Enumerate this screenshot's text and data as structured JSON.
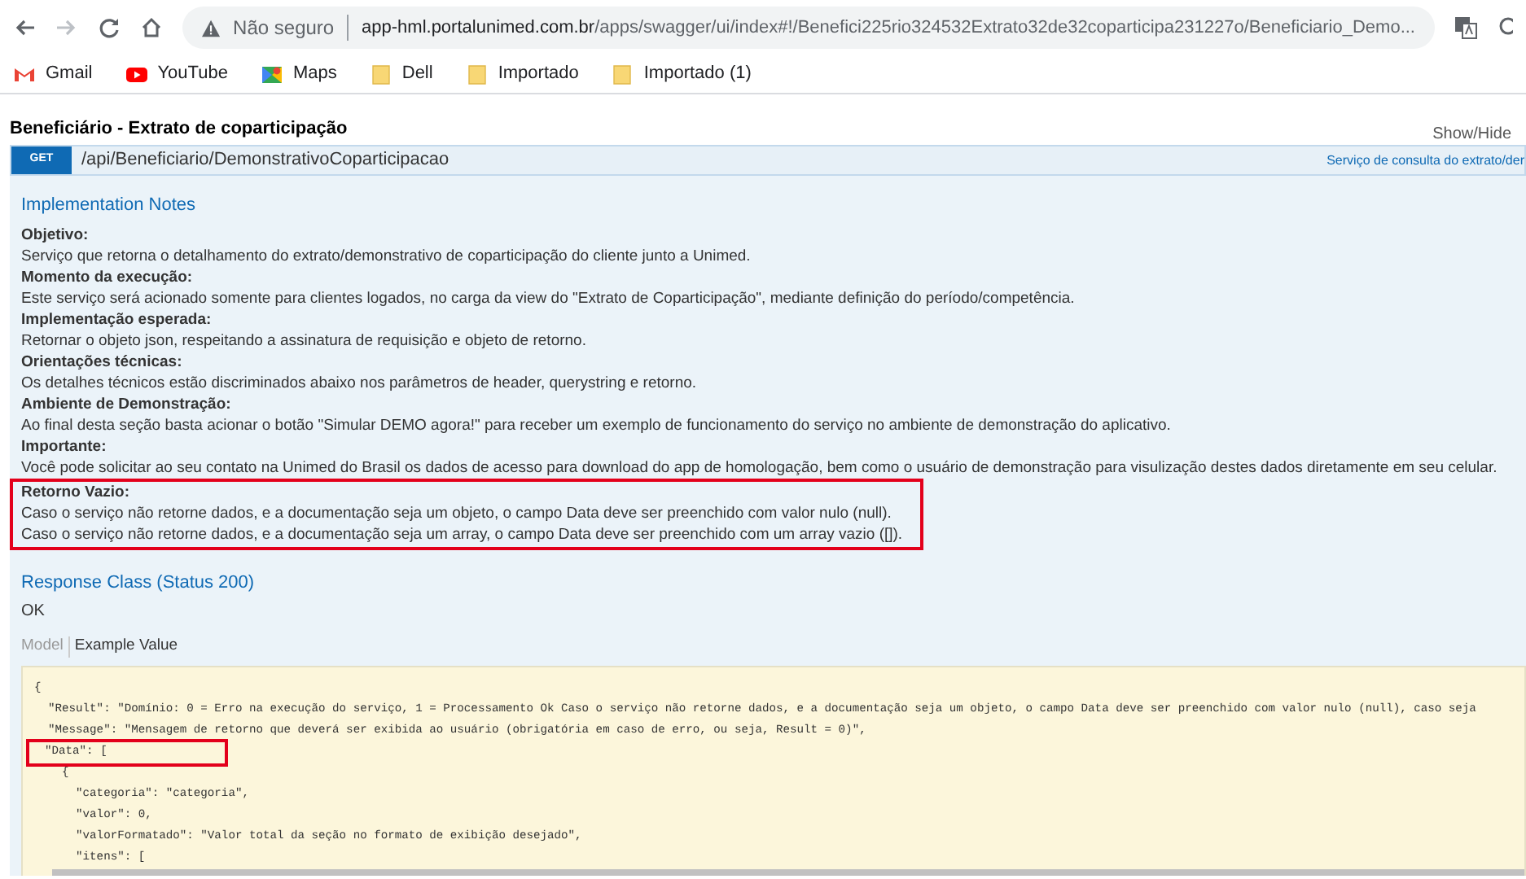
{
  "browser": {
    "nav": [
      {
        "kind": "back",
        "disabled": false
      },
      {
        "kind": "forward",
        "disabled": true
      },
      {
        "kind": "reload",
        "disabled": false
      },
      {
        "kind": "home",
        "disabled": false
      }
    ],
    "security": "Não seguro",
    "url_host": "app-hml.portalunimed.com.br",
    "url_path": "/apps/swagger/ui/index#!/Benefici225rio324532Extrato32de32coparticipa231227o/Beneficiario_Demo...",
    "bookmarks": [
      {
        "kind": "gmail",
        "label": "Gmail"
      },
      {
        "kind": "youtube",
        "label": "YouTube"
      },
      {
        "kind": "maps",
        "label": "Maps"
      },
      {
        "kind": "folder",
        "label": "Dell"
      },
      {
        "kind": "folder",
        "label": "Importado"
      },
      {
        "kind": "folder",
        "label": "Importado (1)"
      }
    ]
  },
  "section": {
    "title": "Beneficiário - Extrato de coparticipação",
    "toggle": "Show/Hide"
  },
  "operation": {
    "method": "GET",
    "path": "/api/Beneficiario/DemonstrativoCoparticipacao",
    "summary": "Serviço de consulta do extrato/der"
  },
  "notes_title": "Implementation Notes",
  "notes": [
    {
      "heading": "Objetivo:",
      "lines": [
        "Serviço que retorna o detalhamento do extrato/demonstrativo de coparticipação do cliente junto a Unimed."
      ],
      "highlighted": false
    },
    {
      "heading": "Momento da execução:",
      "lines": [
        "Este serviço será acionado somente para clientes logados, no carga da view do \"Extrato de Coparticipação\", mediante definição do período/competência."
      ],
      "highlighted": false
    },
    {
      "heading": "Implementação esperada:",
      "lines": [
        "Retornar o objeto json, respeitando a assinatura de requisição e objeto de retorno."
      ],
      "highlighted": false
    },
    {
      "heading": "Orientações técnicas:",
      "lines": [
        "Os detalhes técnicos estão discriminados abaixo nos parâmetros de header, querystring e retorno."
      ],
      "highlighted": false
    },
    {
      "heading": "Ambiente de Demonstração:",
      "lines": [
        "Ao final desta seção basta acionar o botão \"Simular DEMO agora!\" para receber um exemplo de funcionamento do serviço no ambiente de demonstração do aplicativo."
      ],
      "highlighted": false
    },
    {
      "heading": "Importante:",
      "lines": [
        "Você pode solicitar ao seu contato na Unimed do Brasil os dados de acesso para download do app de homologação, bem como o usuário de demonstração para visulização destes dados diretamente em seu celular."
      ],
      "highlighted": false
    },
    {
      "heading": "Retorno Vazio:",
      "lines": [
        "Caso o serviço não retorne dados, e a documentação seja um objeto, o campo Data deve ser preenchido com valor nulo (null).",
        "Caso o serviço não retorne dados, e a documentação seja um array, o campo Data deve ser preenchido com um array vazio ([])."
      ],
      "highlighted": true
    }
  ],
  "response_class": {
    "title": "Response Class (Status 200)",
    "status": "OK"
  },
  "model_tabs": [
    {
      "label": "Model",
      "selected": false
    },
    {
      "label": "Example Value",
      "selected": true
    }
  ],
  "code": [
    {
      "text": "{",
      "highlighted": false
    },
    {
      "text": "  \"Result\": \"Domínio: 0 = Erro na execução do serviço, 1 = Processamento Ok Caso o serviço não retorne dados, e a documentação seja um objeto, o campo Data deve ser preenchido com valor nulo (null), caso seja",
      "highlighted": false
    },
    {
      "text": "  \"Message\": \"Mensagem de retorno que deverá ser exibida ao usuário (obrigatória em caso de erro, ou seja, Result = 0)\",",
      "highlighted": false
    },
    {
      "text": "  \"Data\": [",
      "highlighted": true
    },
    {
      "text": "    {",
      "highlighted": false
    },
    {
      "text": "      \"categoria\": \"categoria\",",
      "highlighted": false
    },
    {
      "text": "      \"valor\": 0,",
      "highlighted": false
    },
    {
      "text": "      \"valorFormatado\": \"Valor total da seção no formato de exibição desejado\",",
      "highlighted": false
    },
    {
      "text": "      \"itens\": [",
      "highlighted": false
    }
  ]
}
